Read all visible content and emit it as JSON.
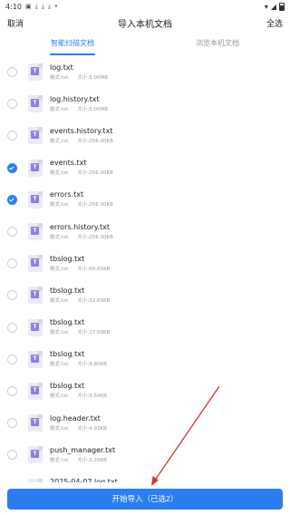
{
  "status_bar": {
    "time": "4:10"
  },
  "header": {
    "cancel": "取消",
    "title": "导入本机文档",
    "select_all": "全选"
  },
  "tabs": [
    {
      "label": "智能扫描文档",
      "active": true
    },
    {
      "label": "浏览本机文档",
      "active": false
    }
  ],
  "files": [
    {
      "name": "log.txt",
      "format": "格式:txt",
      "size": "大小:5.00MB",
      "checked": false
    },
    {
      "name": "log.history.txt",
      "format": "格式:txt",
      "size": "大小:5.00MB",
      "checked": false
    },
    {
      "name": "events.history.txt",
      "format": "格式:txt",
      "size": "大小:256.00KB",
      "checked": false
    },
    {
      "name": "events.txt",
      "format": "格式:txt",
      "size": "大小:256.00KB",
      "checked": true
    },
    {
      "name": "errors.txt",
      "format": "格式:txt",
      "size": "大小:256.00KB",
      "checked": true
    },
    {
      "name": "errors.history.txt",
      "format": "格式:txt",
      "size": "大小:256.00KB",
      "checked": false
    },
    {
      "name": "tbslog.txt",
      "format": "格式:txt",
      "size": "大小:60.65KB",
      "checked": false
    },
    {
      "name": "tbslog.txt",
      "format": "格式:txt",
      "size": "大小:32.65KB",
      "checked": false
    },
    {
      "name": "tbslog.txt",
      "format": "格式:txt",
      "size": "大小:17.09KB",
      "checked": false
    },
    {
      "name": "tbslog.txt",
      "format": "格式:txt",
      "size": "大小:9.80KB",
      "checked": false
    },
    {
      "name": "tbslog.txt",
      "format": "格式:txt",
      "size": "大小:9.64KB",
      "checked": false
    },
    {
      "name": "log.header.txt",
      "format": "格式:txt",
      "size": "大小:4.93KB",
      "checked": false
    },
    {
      "name": "push_manager.txt",
      "format": "格式:txt",
      "size": "大小:3.29KB",
      "checked": false
    },
    {
      "name": "2025-04-07.log.txt",
      "format": "",
      "size": "",
      "checked": false
    }
  ],
  "import_button": {
    "label": "开始导入（已选2）"
  },
  "colors": {
    "accent": "#2a7ef0",
    "annotation_arrow": "#d8332b"
  }
}
